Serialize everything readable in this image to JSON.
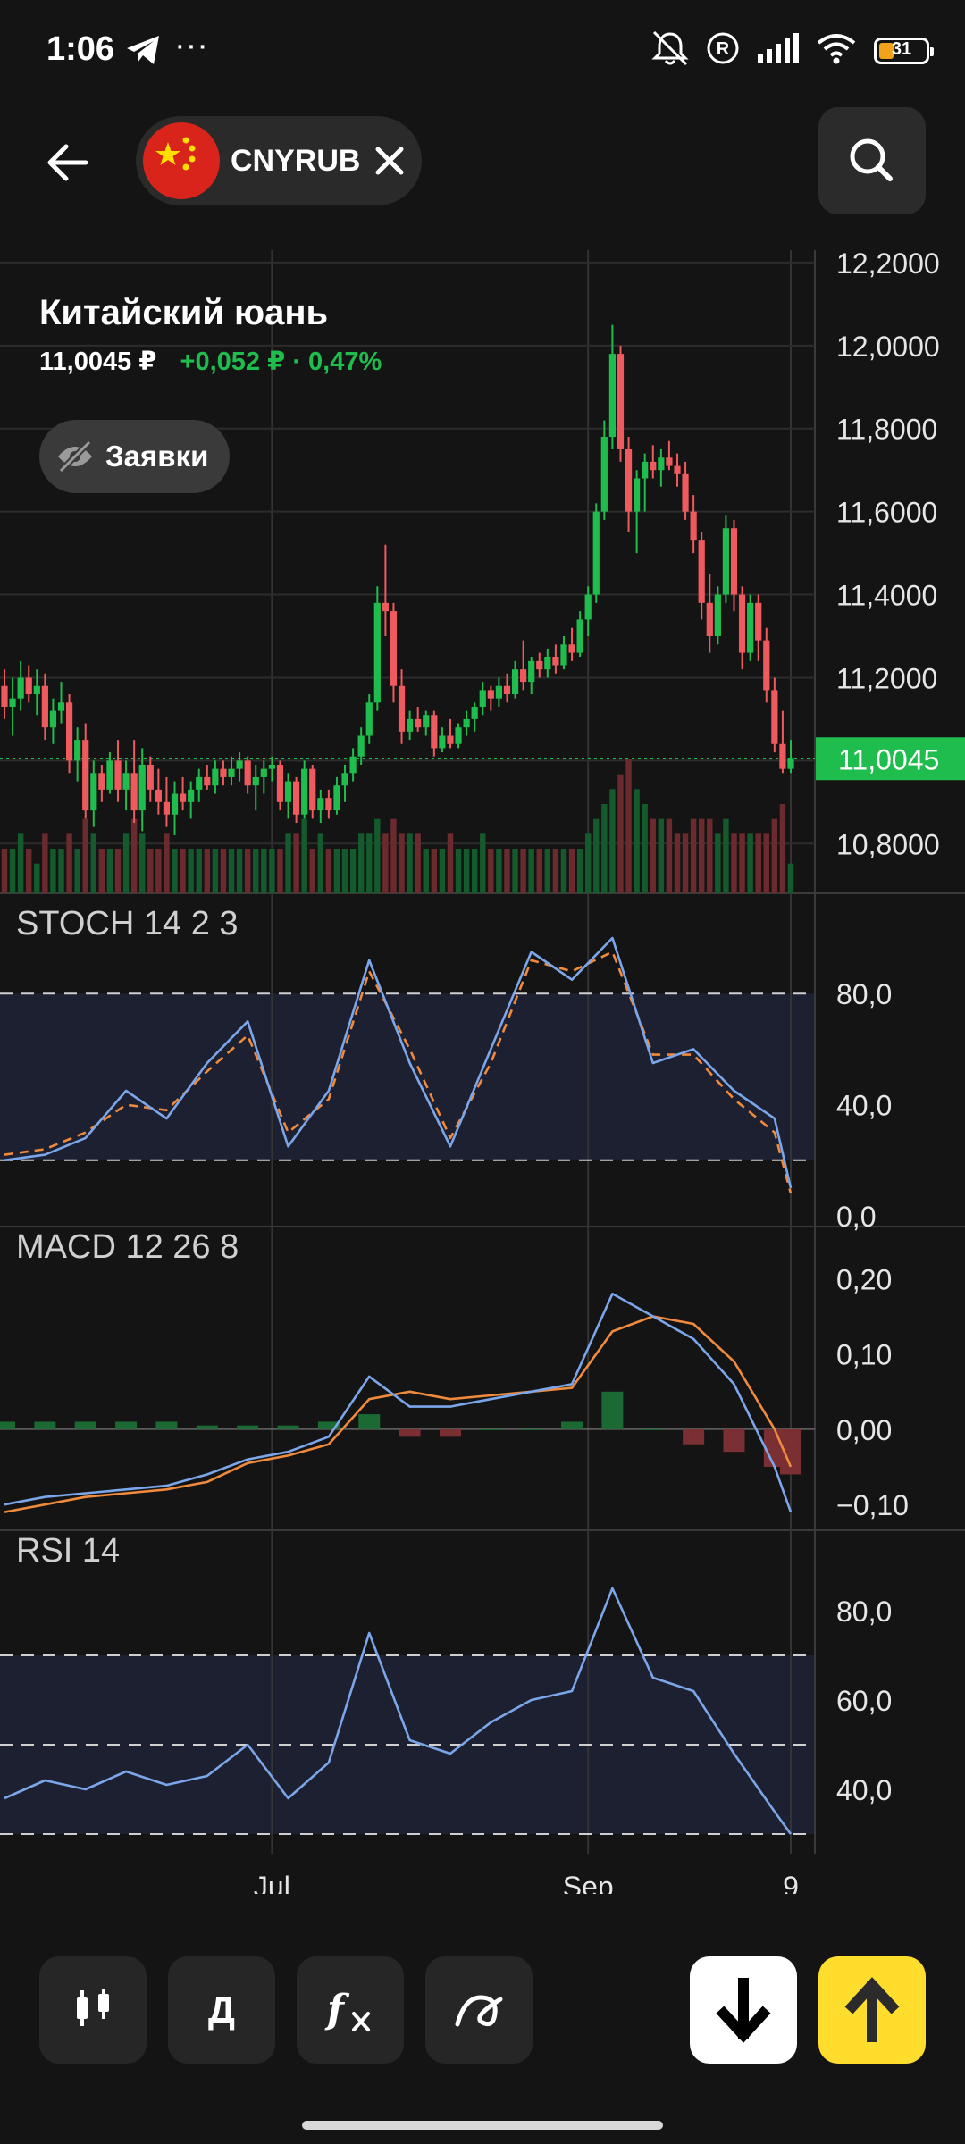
{
  "status_bar": {
    "time": "1:06",
    "battery_level": "31",
    "icons": [
      "telegram-icon",
      "more-dots-icon",
      "mute-bell-icon",
      "registered-icon",
      "signal-icon",
      "wifi-icon",
      "battery-icon"
    ]
  },
  "header": {
    "ticker": "CNYRUB",
    "icons": [
      "back-arrow-icon",
      "china-flag-icon",
      "close-icon",
      "search-icon"
    ]
  },
  "instrument": {
    "name": "Китайский юань",
    "price": "11,0045 ₽",
    "change": "+0,052 ₽ · 0,47%",
    "orders_label": "Заявки"
  },
  "colors": {
    "background": "#141414",
    "up": "#1fbd4d",
    "down": "#ef5a5f",
    "price_tag": "#1fbd4d",
    "stoch_k": "#7ba6ea",
    "stoch_d": "#f08a3c",
    "buy_button": "#ffdd2d",
    "sell_button": "#ffffff"
  },
  "toolbar": {
    "period_label": "Д",
    "buttons": [
      "candles-icon",
      "period-button",
      "indicators-icon",
      "drawing-icon",
      "sell-arrow-down-icon",
      "buy-arrow-up-icon"
    ]
  },
  "chart_data": [
    {
      "type": "candlestick",
      "title": "CNYRUB",
      "y_ticks": [
        "12,2000",
        "12,0000",
        "11,8000",
        "11,6000",
        "11,4000",
        "11,2000",
        "11,0000",
        "10,8000"
      ],
      "ylim": [
        10.68,
        12.23
      ],
      "current_price_label": "11,0045",
      "current_price": 11.0045,
      "x_ticks": [
        "Jul",
        "Sep",
        "9"
      ],
      "x_tick_index": [
        33,
        72,
        97
      ],
      "ohlc": [
        [
          11.18,
          11.22,
          11.1,
          11.13
        ],
        [
          11.13,
          11.2,
          11.06,
          11.15
        ],
        [
          11.15,
          11.24,
          11.12,
          11.2
        ],
        [
          11.2,
          11.23,
          11.14,
          11.16
        ],
        [
          11.16,
          11.22,
          11.11,
          11.18
        ],
        [
          11.18,
          11.21,
          11.05,
          11.08
        ],
        [
          11.08,
          11.15,
          11.04,
          11.12
        ],
        [
          11.12,
          11.19,
          11.09,
          11.14
        ],
        [
          11.14,
          11.16,
          10.97,
          11.0
        ],
        [
          11.0,
          11.08,
          10.95,
          11.05
        ],
        [
          11.05,
          11.09,
          10.86,
          10.88
        ],
        [
          10.88,
          11.0,
          10.84,
          10.97
        ],
        [
          10.97,
          10.99,
          10.9,
          10.93
        ],
        [
          10.93,
          11.02,
          10.92,
          11.0
        ],
        [
          11.0,
          11.05,
          10.9,
          10.93
        ],
        [
          10.93,
          11.0,
          10.88,
          10.97
        ],
        [
          10.97,
          11.05,
          10.85,
          10.88
        ],
        [
          10.88,
          11.03,
          10.83,
          10.99
        ],
        [
          10.99,
          11.01,
          10.9,
          10.93
        ],
        [
          10.93,
          10.98,
          10.87,
          10.9
        ],
        [
          10.9,
          10.96,
          10.84,
          10.87
        ],
        [
          10.87,
          10.95,
          10.82,
          10.92
        ],
        [
          10.92,
          10.96,
          10.88,
          10.9
        ],
        [
          10.9,
          10.95,
          10.86,
          10.93
        ],
        [
          10.93,
          10.98,
          10.9,
          10.96
        ],
        [
          10.96,
          10.99,
          10.93,
          10.94
        ],
        [
          10.94,
          11.0,
          10.92,
          10.98
        ],
        [
          10.98,
          11.0,
          10.94,
          10.96
        ],
        [
          10.96,
          11.01,
          10.94,
          10.98
        ],
        [
          10.98,
          11.02,
          10.95,
          11.0
        ],
        [
          11.0,
          11.01,
          10.92,
          10.94
        ],
        [
          10.94,
          10.99,
          10.88,
          10.96
        ],
        [
          10.96,
          11.0,
          10.92,
          10.98
        ],
        [
          10.98,
          11.01,
          10.95,
          10.99
        ],
        [
          10.99,
          11.0,
          10.88,
          10.9
        ],
        [
          10.9,
          10.97,
          10.86,
          10.95
        ],
        [
          10.95,
          10.96,
          10.85,
          10.87
        ],
        [
          10.87,
          11.0,
          10.86,
          10.98
        ],
        [
          10.98,
          10.99,
          10.86,
          10.88
        ],
        [
          10.88,
          10.93,
          10.85,
          10.91
        ],
        [
          10.91,
          10.93,
          10.86,
          10.88
        ],
        [
          10.88,
          10.96,
          10.87,
          10.94
        ],
        [
          10.94,
          10.99,
          10.9,
          10.97
        ],
        [
          10.97,
          11.03,
          10.95,
          11.01
        ],
        [
          11.01,
          11.08,
          10.99,
          11.06
        ],
        [
          11.06,
          11.16,
          11.04,
          11.14
        ],
        [
          11.14,
          11.42,
          11.12,
          11.38
        ],
        [
          11.38,
          11.52,
          11.3,
          11.36
        ],
        [
          11.36,
          11.38,
          11.14,
          11.18
        ],
        [
          11.18,
          11.22,
          11.04,
          11.07
        ],
        [
          11.07,
          11.12,
          11.05,
          11.1
        ],
        [
          11.1,
          11.13,
          11.07,
          11.08
        ],
        [
          11.08,
          11.12,
          11.06,
          11.11
        ],
        [
          11.11,
          11.12,
          11.01,
          11.03
        ],
        [
          11.03,
          11.08,
          11.02,
          11.06
        ],
        [
          11.06,
          11.1,
          11.03,
          11.04
        ],
        [
          11.04,
          11.09,
          11.03,
          11.08
        ],
        [
          11.08,
          11.12,
          11.06,
          11.1
        ],
        [
          11.1,
          11.14,
          11.07,
          11.13
        ],
        [
          11.13,
          11.19,
          11.11,
          11.17
        ],
        [
          11.17,
          11.18,
          11.12,
          11.15
        ],
        [
          11.15,
          11.2,
          11.13,
          11.18
        ],
        [
          11.18,
          11.21,
          11.14,
          11.16
        ],
        [
          11.16,
          11.24,
          11.15,
          11.22
        ],
        [
          11.22,
          11.29,
          11.17,
          11.19
        ],
        [
          11.19,
          11.25,
          11.16,
          11.24
        ],
        [
          11.24,
          11.26,
          11.2,
          11.22
        ],
        [
          11.22,
          11.27,
          11.2,
          11.25
        ],
        [
          11.25,
          11.28,
          11.21,
          11.23
        ],
        [
          11.23,
          11.3,
          11.22,
          11.28
        ],
        [
          11.28,
          11.32,
          11.24,
          11.26
        ],
        [
          11.26,
          11.36,
          11.25,
          11.34
        ],
        [
          11.34,
          11.42,
          11.3,
          11.4
        ],
        [
          11.4,
          11.62,
          11.38,
          11.6
        ],
        [
          11.6,
          11.82,
          11.58,
          11.78
        ],
        [
          11.78,
          12.05,
          11.75,
          11.98
        ],
        [
          11.98,
          12.0,
          11.72,
          11.75
        ],
        [
          11.75,
          11.78,
          11.55,
          11.6
        ],
        [
          11.6,
          11.7,
          11.5,
          11.68
        ],
        [
          11.68,
          11.74,
          11.6,
          11.72
        ],
        [
          11.72,
          11.76,
          11.68,
          11.7
        ],
        [
          11.7,
          11.75,
          11.66,
          11.73
        ],
        [
          11.73,
          11.77,
          11.7,
          11.71
        ],
        [
          11.71,
          11.74,
          11.66,
          11.69
        ],
        [
          11.69,
          11.72,
          11.58,
          11.6
        ],
        [
          11.6,
          11.64,
          11.5,
          11.53
        ],
        [
          11.53,
          11.55,
          11.34,
          11.38
        ],
        [
          11.38,
          11.45,
          11.26,
          11.3
        ],
        [
          11.3,
          11.42,
          11.28,
          11.4
        ],
        [
          11.4,
          11.59,
          11.38,
          11.56
        ],
        [
          11.56,
          11.58,
          11.36,
          11.4
        ],
        [
          11.4,
          11.42,
          11.22,
          11.26
        ],
        [
          11.26,
          11.4,
          11.24,
          11.38
        ],
        [
          11.38,
          11.4,
          11.24,
          11.29
        ],
        [
          11.29,
          11.32,
          11.14,
          11.17
        ],
        [
          11.17,
          11.2,
          11.02,
          11.04
        ],
        [
          11.04,
          11.12,
          10.97,
          10.98
        ],
        [
          10.98,
          11.05,
          10.97,
          11.0045
        ]
      ],
      "volume": [
        3,
        3,
        4,
        3,
        2,
        4,
        3,
        3,
        4,
        3,
        5,
        4,
        3,
        3,
        3,
        4,
        5,
        4,
        3,
        3,
        4,
        3,
        3,
        3,
        3,
        3,
        3,
        3,
        3,
        3,
        3,
        3,
        3,
        3,
        3,
        4,
        4,
        5,
        3,
        4,
        3,
        3,
        3,
        3,
        4,
        4,
        5,
        4,
        5,
        4,
        4,
        4,
        3,
        3,
        3,
        4,
        3,
        3,
        3,
        4,
        3,
        3,
        3,
        3,
        3,
        3,
        3,
        3,
        3,
        3,
        3,
        3,
        4,
        5,
        6,
        7,
        8,
        9,
        7,
        6,
        5,
        5,
        5,
        4,
        4,
        5,
        5,
        5,
        4,
        5,
        4,
        4,
        4,
        4,
        4,
        5,
        6,
        2
      ]
    },
    {
      "type": "line",
      "title": "STOCH 14 2 3",
      "y_ticks": [
        "80,0",
        "40,0",
        "0,0"
      ],
      "ylim": [
        0,
        100
      ],
      "levels": [
        80,
        20
      ],
      "x": [
        0,
        5,
        10,
        15,
        20,
        25,
        30,
        35,
        40,
        45,
        50,
        55,
        60,
        65,
        70,
        75,
        80,
        85,
        90,
        95,
        97
      ],
      "series": [
        {
          "values": [
            20,
            22,
            28,
            45,
            35,
            55,
            70,
            25,
            45,
            92,
            55,
            25,
            60,
            95,
            85,
            100,
            55,
            60,
            45,
            35,
            10
          ]
        },
        {
          "values": [
            22,
            24,
            30,
            40,
            38,
            52,
            65,
            30,
            42,
            88,
            60,
            28,
            55,
            92,
            88,
            95,
            58,
            58,
            42,
            30,
            8
          ]
        }
      ]
    },
    {
      "type": "line",
      "title": "MACD 12 26 8",
      "y_ticks": [
        "0,20",
        "0,10",
        "0,00",
        "−0,10"
      ],
      "ylim": [
        -0.12,
        0.21
      ],
      "x": [
        0,
        5,
        10,
        15,
        20,
        25,
        30,
        35,
        40,
        45,
        50,
        55,
        60,
        65,
        70,
        75,
        80,
        85,
        90,
        95,
        97
      ],
      "series": [
        {
          "values": [
            -0.1,
            -0.09,
            -0.085,
            -0.08,
            -0.075,
            -0.06,
            -0.04,
            -0.03,
            -0.01,
            0.07,
            0.03,
            0.03,
            0.04,
            0.05,
            0.06,
            0.18,
            0.15,
            0.12,
            0.06,
            -0.05,
            -0.11
          ]
        },
        {
          "values": [
            -0.11,
            -0.1,
            -0.09,
            -0.085,
            -0.08,
            -0.07,
            -0.045,
            -0.035,
            -0.02,
            0.04,
            0.05,
            0.04,
            0.045,
            0.05,
            0.055,
            0.13,
            0.15,
            0.14,
            0.09,
            0.0,
            -0.05
          ]
        }
      ],
      "histogram": [
        0.01,
        0.01,
        0.01,
        0.01,
        0.01,
        0.005,
        0.005,
        0.005,
        0.01,
        0.02,
        -0.01,
        -0.01,
        0.0,
        0.0,
        0.01,
        0.05,
        0.0,
        -0.02,
        -0.03,
        -0.05,
        -0.06
      ]
    },
    {
      "type": "line",
      "title": "RSI 14",
      "y_ticks": [
        "80,0",
        "60,0",
        "40,0"
      ],
      "ylim": [
        28,
        88
      ],
      "levels": [
        70,
        50,
        30
      ],
      "x": [
        0,
        5,
        10,
        15,
        20,
        25,
        30,
        35,
        40,
        45,
        50,
        55,
        60,
        65,
        70,
        75,
        80,
        85,
        90,
        95,
        97
      ],
      "series": [
        {
          "values": [
            38,
            42,
            40,
            44,
            41,
            43,
            50,
            38,
            46,
            75,
            51,
            48,
            55,
            60,
            62,
            85,
            65,
            62,
            48,
            35,
            30
          ]
        }
      ]
    }
  ]
}
